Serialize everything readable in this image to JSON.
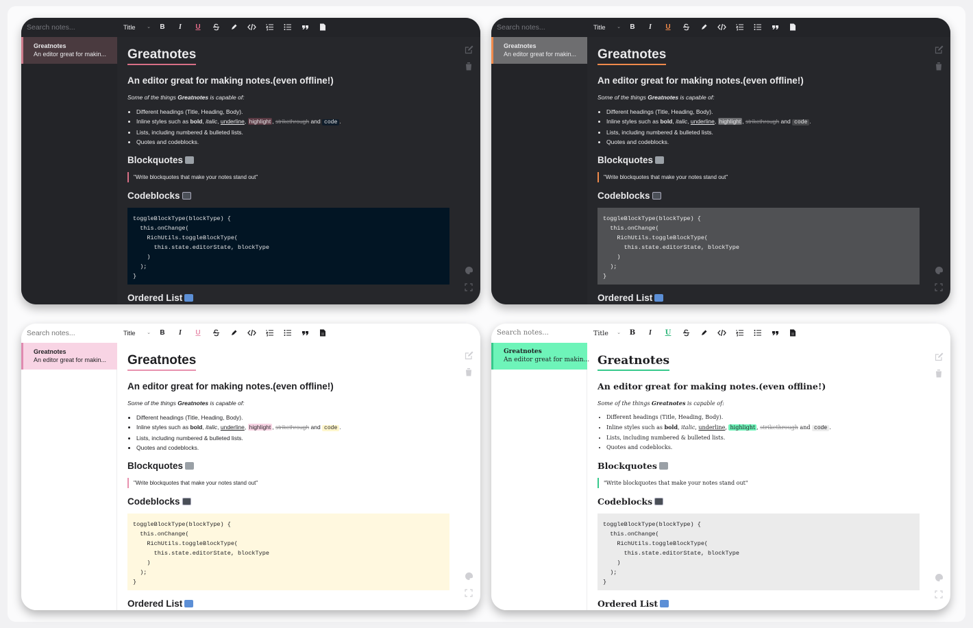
{
  "search": {
    "placeholder": "Search notes..."
  },
  "toolbar": {
    "block_type": "Title",
    "bold": "B",
    "italic": "I",
    "underline": "U",
    "quote": "❞"
  },
  "note": {
    "title": "Greatnotes",
    "preview": "An editor great for makin..."
  },
  "doc": {
    "title": "Greatnotes",
    "heading": "An editor great for making notes.(even offline!)",
    "intro_pre": "Some of the things ",
    "intro_bold": "Greatnotes",
    "intro_post": " is capable of:",
    "bullet1": "Different headings (Title, Heading, Body).",
    "bullet2_pre": "Inline styles such as ",
    "bullet2_bold": "bold",
    "bullet2_comma1": ", ",
    "bullet2_italic": "italic",
    "bullet2_comma2": ", ",
    "bullet2_underline": "underline",
    "bullet2_comma3": ", ",
    "bullet2_highlight": "highlight",
    "bullet2_comma4": ", ",
    "bullet2_strike": "strikethrough",
    "bullet2_and": " and ",
    "bullet2_code": "code",
    "bullet2_end": ".",
    "bullet3": "Lists, including numbered & bulleted lists.",
    "bullet4": "Quotes and codeblocks.",
    "blockquotes": "Blockquotes",
    "quote": "\"Write blockquotes that make your notes stand out\"",
    "codeblocks": "Codeblocks",
    "code": "toggleBlockType(blockType) {\n  this.onChange(\n    RichUtils.toggleBlockType(\n      this.state.editorState, blockType\n    )\n  );\n}",
    "ordered_list": "Ordered List"
  },
  "themes": [
    {
      "name": "dark-rose",
      "accent": "#d86f86",
      "code_bg": "#021524"
    },
    {
      "name": "dark-orange",
      "accent": "#f08a4b",
      "code_bg": "#505154"
    },
    {
      "name": "light-pink",
      "accent": "#e891ae",
      "code_bg": "#fff8df"
    },
    {
      "name": "light-mint",
      "accent": "#36c98b",
      "code_bg": "#ebebeb"
    }
  ],
  "icons": [
    "strikethrough-icon",
    "highlighter-icon",
    "code-icon",
    "ordered-list-icon",
    "bullet-list-icon",
    "quote-icon",
    "codeblock-icon",
    "edit-icon",
    "trash-icon",
    "palette-icon",
    "fullscreen-icon",
    "megaphone-icon",
    "monitor-icon",
    "numbers-icon"
  ]
}
